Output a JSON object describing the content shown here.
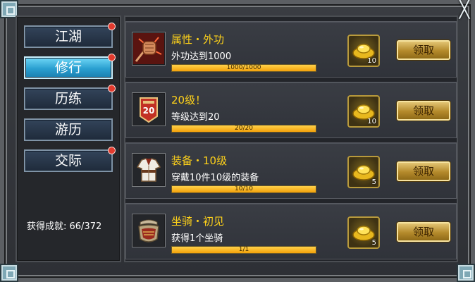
{
  "close_label": "╳",
  "tabs": [
    {
      "label": "江湖",
      "active": false,
      "dot": true
    },
    {
      "label": "修行",
      "active": true,
      "dot": true
    },
    {
      "label": "历练",
      "active": false,
      "dot": true
    },
    {
      "label": "游历",
      "active": false,
      "dot": false
    },
    {
      "label": "交际",
      "active": false,
      "dot": true
    }
  ],
  "achievement_text": "获得成就: 66/372",
  "claim_label": "领取",
  "rows": [
    {
      "icon": "fist-icon",
      "title": "属性・外功",
      "desc": "外功达到1000",
      "progress_text": "1000/1000",
      "progress": 1.0,
      "reward_icon": "gold-ingot-icon",
      "reward_count": "10"
    },
    {
      "icon": "level-badge-icon",
      "badge": "20",
      "title": "20级！",
      "desc": "等级达到20",
      "progress_text": "20/20",
      "progress": 1.0,
      "reward_icon": "gold-ingot-icon",
      "reward_count": "10"
    },
    {
      "icon": "armor-icon",
      "title": "装备・10级",
      "desc": "穿戴10件10级的装备",
      "progress_text": "10/10",
      "progress": 1.0,
      "reward_icon": "gold-ingot-icon",
      "reward_count": "5"
    },
    {
      "icon": "saddle-icon",
      "title": "坐骑・初见",
      "desc": "获得1个坐骑",
      "progress_text": "1/1",
      "progress": 1.0,
      "reward_icon": "gold-ingot-icon",
      "reward_count": "5"
    }
  ],
  "colors": {
    "title": "#ffd21a",
    "bar": "#f3a10a",
    "active_tab": "#2a9fd0",
    "dot": "#e23a2d"
  }
}
